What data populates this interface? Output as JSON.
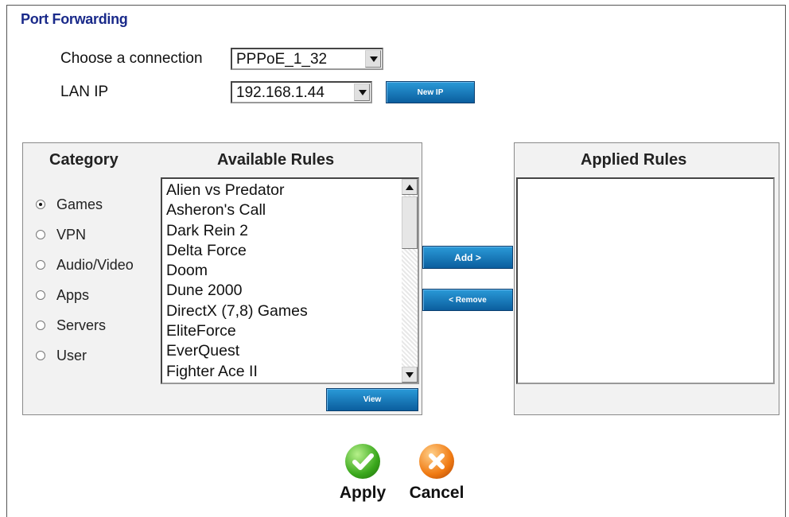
{
  "title": "Port Forwarding",
  "connection": {
    "label": "Choose a connection",
    "value": "PPPoE_1_32"
  },
  "lan_ip": {
    "label": "LAN IP",
    "value": "192.168.1.44",
    "new_ip_button": "New IP"
  },
  "category": {
    "header": "Category",
    "options": [
      {
        "label": "Games",
        "selected": true
      },
      {
        "label": "VPN",
        "selected": false
      },
      {
        "label": "Audio/Video",
        "selected": false
      },
      {
        "label": "Apps",
        "selected": false
      },
      {
        "label": "Servers",
        "selected": false
      },
      {
        "label": "User",
        "selected": false
      }
    ]
  },
  "available_rules": {
    "header": "Available Rules",
    "items": [
      "Alien vs Predator",
      "Asheron's Call",
      "Dark Rein 2",
      "Delta Force",
      "Doom",
      "Dune 2000",
      "DirectX (7,8) Games",
      "EliteForce",
      "EverQuest",
      "Fighter Ace II"
    ],
    "view_button": "View"
  },
  "transfer": {
    "add_button": "Add >",
    "remove_button": "< Remove"
  },
  "applied_rules": {
    "header": "Applied Rules",
    "items": []
  },
  "actions": {
    "apply_label": "Apply",
    "cancel_label": "Cancel"
  },
  "icons": {
    "apply": "check-icon",
    "cancel": "x-icon"
  },
  "colors": {
    "title": "#1a2a8a",
    "button_blue": "#0b6fb4",
    "apply_green": "#3aa81c",
    "cancel_orange": "#f07a12"
  }
}
